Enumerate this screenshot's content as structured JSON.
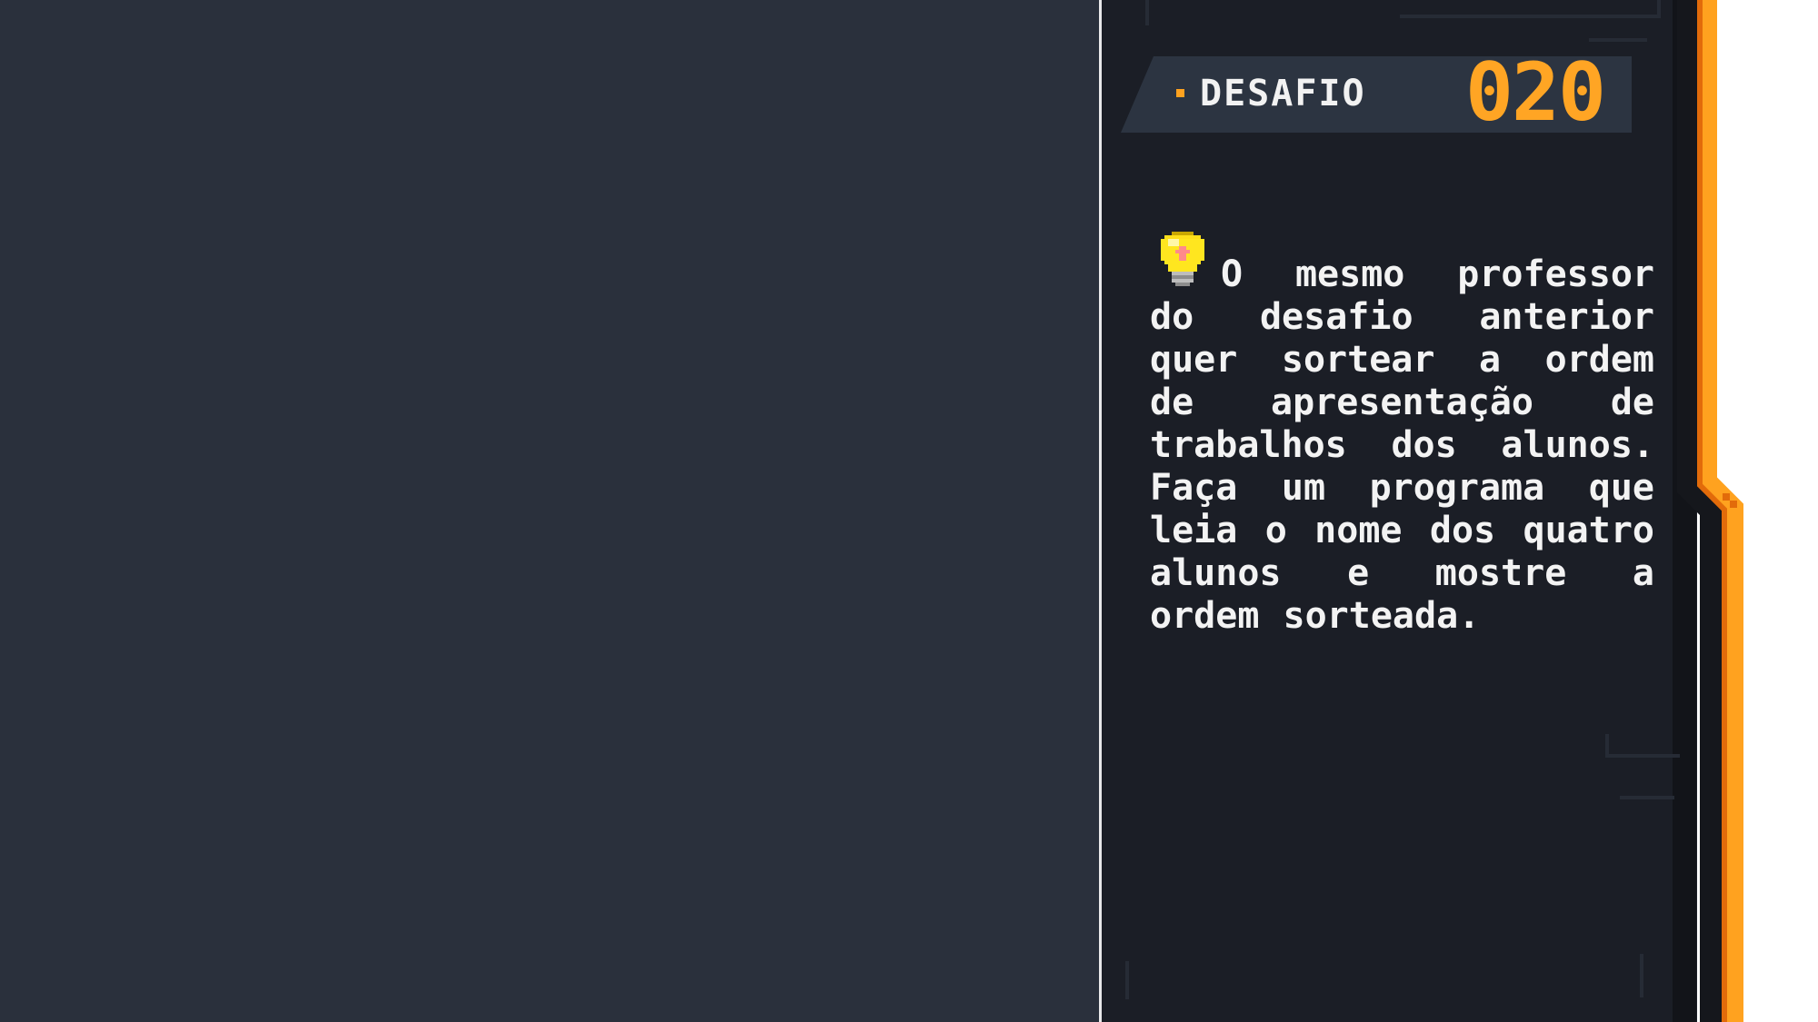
{
  "challenge": {
    "label": "DESAFIO",
    "number": "020",
    "hint_icon": "lightbulb-icon",
    "description": "O mesmo professor do desafio anterior quer sortear a ordem de apresentação de trabalhos dos alunos. Faça um programa que leia o nome dos quatro alunos e mostre a ordem sorteada."
  },
  "colors": {
    "background_left": "#2a303c",
    "panel": "#1b1e26",
    "accent_orange": "#ffa21f",
    "accent_orange_dark": "#e26b0a",
    "text": "#f3f3f3"
  }
}
